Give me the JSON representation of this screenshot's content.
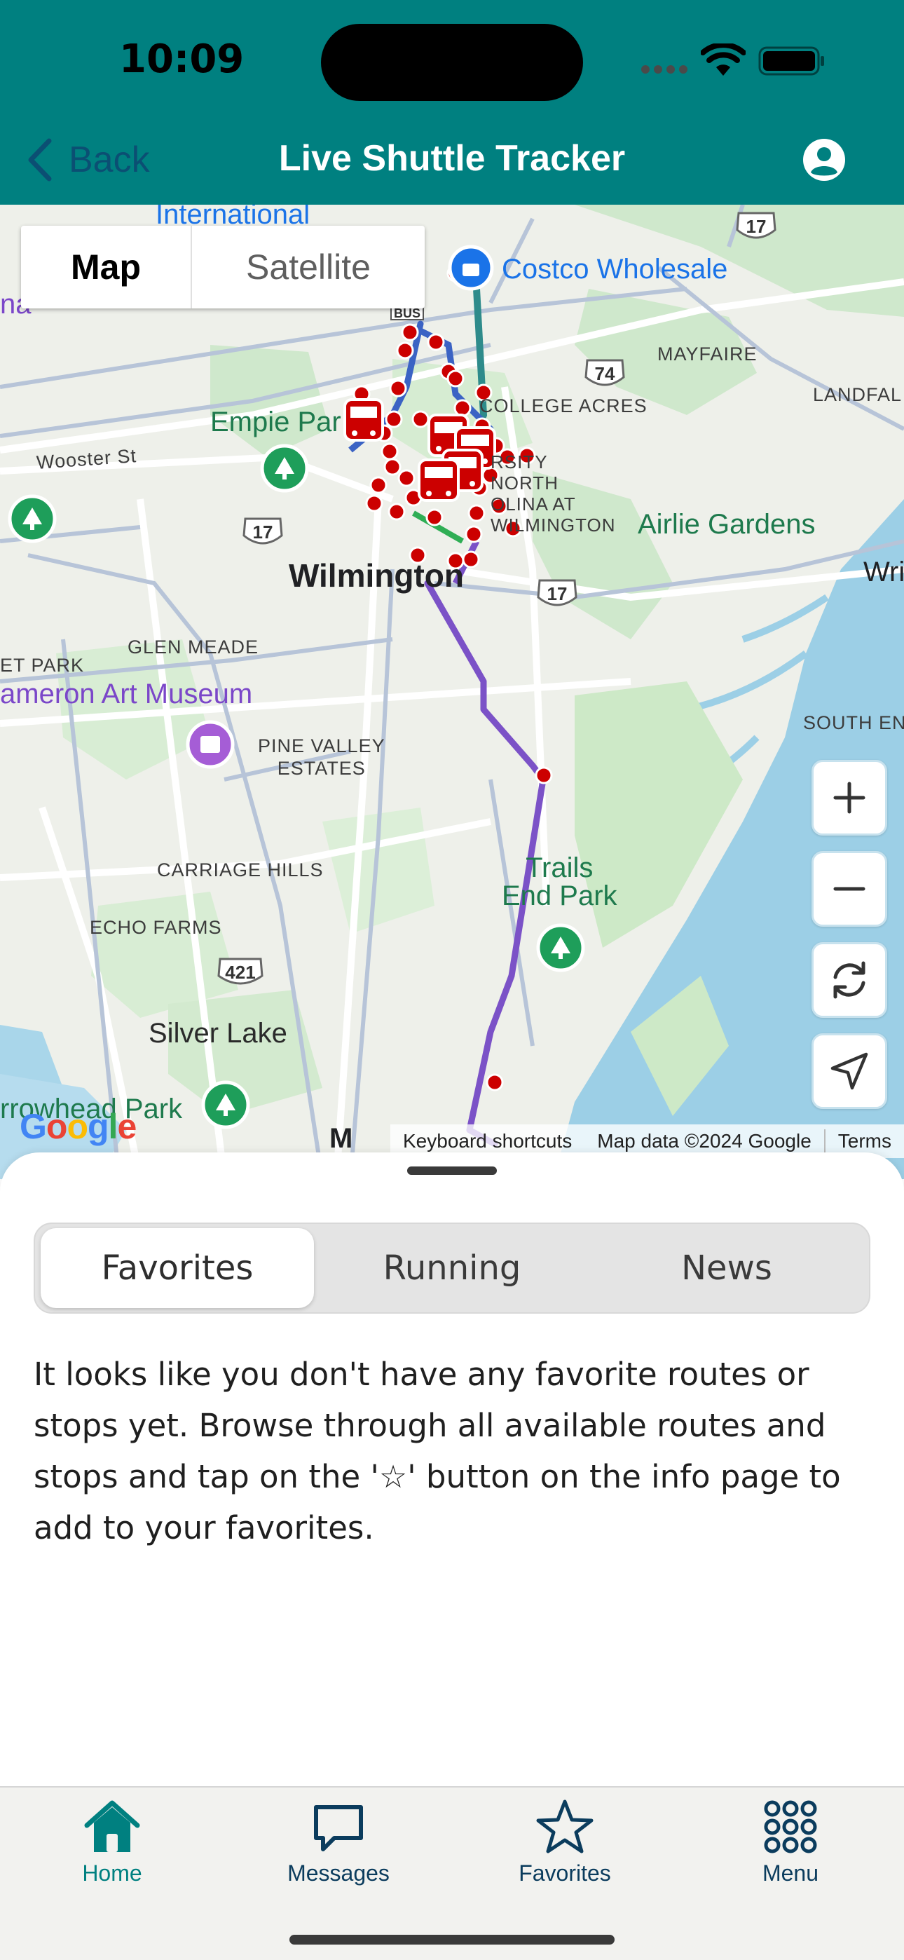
{
  "status_bar": {
    "time": "10:09"
  },
  "nav": {
    "back_label": "Back",
    "title": "Live Shuttle Tracker",
    "account_icon": "person-circle-icon"
  },
  "map": {
    "type_toggle": {
      "map_label": "Map",
      "satellite_label": "Satellite",
      "selected": "Map"
    },
    "labels": {
      "international": "International",
      "costco": "Costco Wholesale",
      "mayfaire": "MAYFAIRE",
      "landfall": "LANDFAL",
      "college_acres": "COLLEGE ACRES",
      "empie_park": "Empie Par",
      "wooster_st": "Wooster St",
      "unc": "RSITY\nNORTH\nOLINA AT\nWILMINGTON",
      "airlie": "Airlie Gardens",
      "wilmington": "Wilmington",
      "wri": "Wri",
      "glen_meade": "GLEN MEADE",
      "et_park": "ET PARK",
      "cameron": "ameron Art Museum",
      "pine_valley": "PINE VALLEY\nESTATES",
      "south_end": "SOUTH EN",
      "carriage_hills": "CARRIAGE HILLS",
      "trails_end": "Trails\nEnd Park",
      "echo_farms": "ECHO FARMS",
      "silver_lake": "Silver Lake",
      "arrowhead": "rrowhead Park",
      "na": "na",
      "bus": "BUS",
      "m": "M"
    },
    "shields": [
      "17",
      "74",
      "17",
      "17",
      "421"
    ],
    "controls": {
      "zoom_in": "plus-icon",
      "zoom_out": "minus-icon",
      "refresh": "refresh-icon",
      "locate": "location-arrow-icon"
    },
    "google_logo": "Google",
    "attribution": {
      "shortcuts": "Keyboard shortcuts",
      "data": "Map data ©2024 Google",
      "terms": "Terms"
    }
  },
  "sheet": {
    "tabs": [
      {
        "label": "Favorites",
        "active": true
      },
      {
        "label": "Running",
        "active": false
      },
      {
        "label": "News",
        "active": false
      }
    ],
    "empty_message": "It looks like you don't have any favorite routes or stops yet. Browse through all available routes and stops and tap on the '☆' button on the info page to add to your favorites."
  },
  "tab_bar": {
    "items": [
      {
        "label": "Home",
        "icon": "house-icon",
        "active": true
      },
      {
        "label": "Messages",
        "icon": "chat-bubble-icon",
        "active": false
      },
      {
        "label": "Favorites",
        "icon": "star-icon",
        "active": false
      },
      {
        "label": "Menu",
        "icon": "grid-dots-icon",
        "active": false
      }
    ]
  },
  "colors": {
    "header": "#008080",
    "route_purple": "#7b52c7",
    "route_teal": "#2e8b8b",
    "route_blue": "#3b63c4",
    "stop_red": "#cc0000",
    "park_green": "#1e9e5a"
  }
}
